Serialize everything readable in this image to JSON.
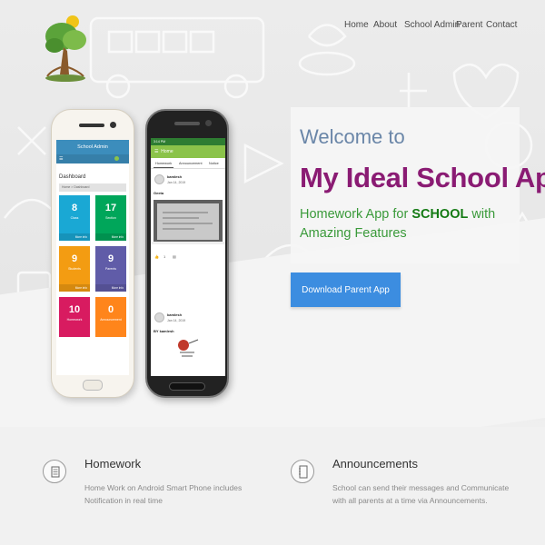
{
  "nav": {
    "items": [
      {
        "label": "Home"
      },
      {
        "label": "About"
      },
      {
        "label": "School Admin"
      },
      {
        "label": "Parent"
      },
      {
        "label": "Contact"
      }
    ]
  },
  "hero": {
    "welcome": "Welcome to",
    "title": "My Ideal School App",
    "subtitle_prefix": "Homework App for ",
    "subtitle_emphasis": "SCHOOL",
    "subtitle_suffix": " with Amazing Features",
    "download_button": "Download Parent App"
  },
  "admin_phone": {
    "header": "School Admin",
    "dashboard_title": "Dashboard",
    "breadcrumb": "Home > Dashboard",
    "tiles": [
      {
        "value": "8",
        "label": "Class",
        "more": "More info",
        "color": "#1aa8d4"
      },
      {
        "value": "17",
        "label": "Section",
        "more": "More info",
        "color": "#00a65a"
      },
      {
        "value": "9",
        "label": "Students",
        "more": "More info",
        "color": "#f39c12"
      },
      {
        "value": "9",
        "label": "Parents",
        "more": "More info",
        "color": "#605ca8"
      },
      {
        "value": "10",
        "label": "Homework",
        "more": "",
        "color": "#d81b60"
      },
      {
        "value": "0",
        "label": "Announcement",
        "more": "",
        "color": "#ff851b"
      }
    ]
  },
  "parent_phone": {
    "status": "3:14 PM",
    "bar_title": "Home",
    "tabs": [
      "Homework",
      "Announcement",
      "Notice"
    ],
    "posts": [
      {
        "name": "kamlesh",
        "date": "Jan 14, 2019",
        "text": "Geeta",
        "likes": "1"
      },
      {
        "name": "kamlesh",
        "date": "Jan 14, 2019",
        "text": "BY kamlesh"
      }
    ]
  },
  "features": [
    {
      "icon": "homework-book-icon",
      "title": "Homework",
      "desc": "Home Work on Android Smart Phone includes Notification in real time"
    },
    {
      "icon": "announcement-notebook-icon",
      "title": "Announcements",
      "desc": "School can send their messages and Communicate with all parents at a time via Announcements."
    }
  ],
  "colors": {
    "title": "#8a1b73",
    "welcome": "#6a86a8",
    "subtitle": "#3a9a3a",
    "button": "#3c8de0"
  }
}
